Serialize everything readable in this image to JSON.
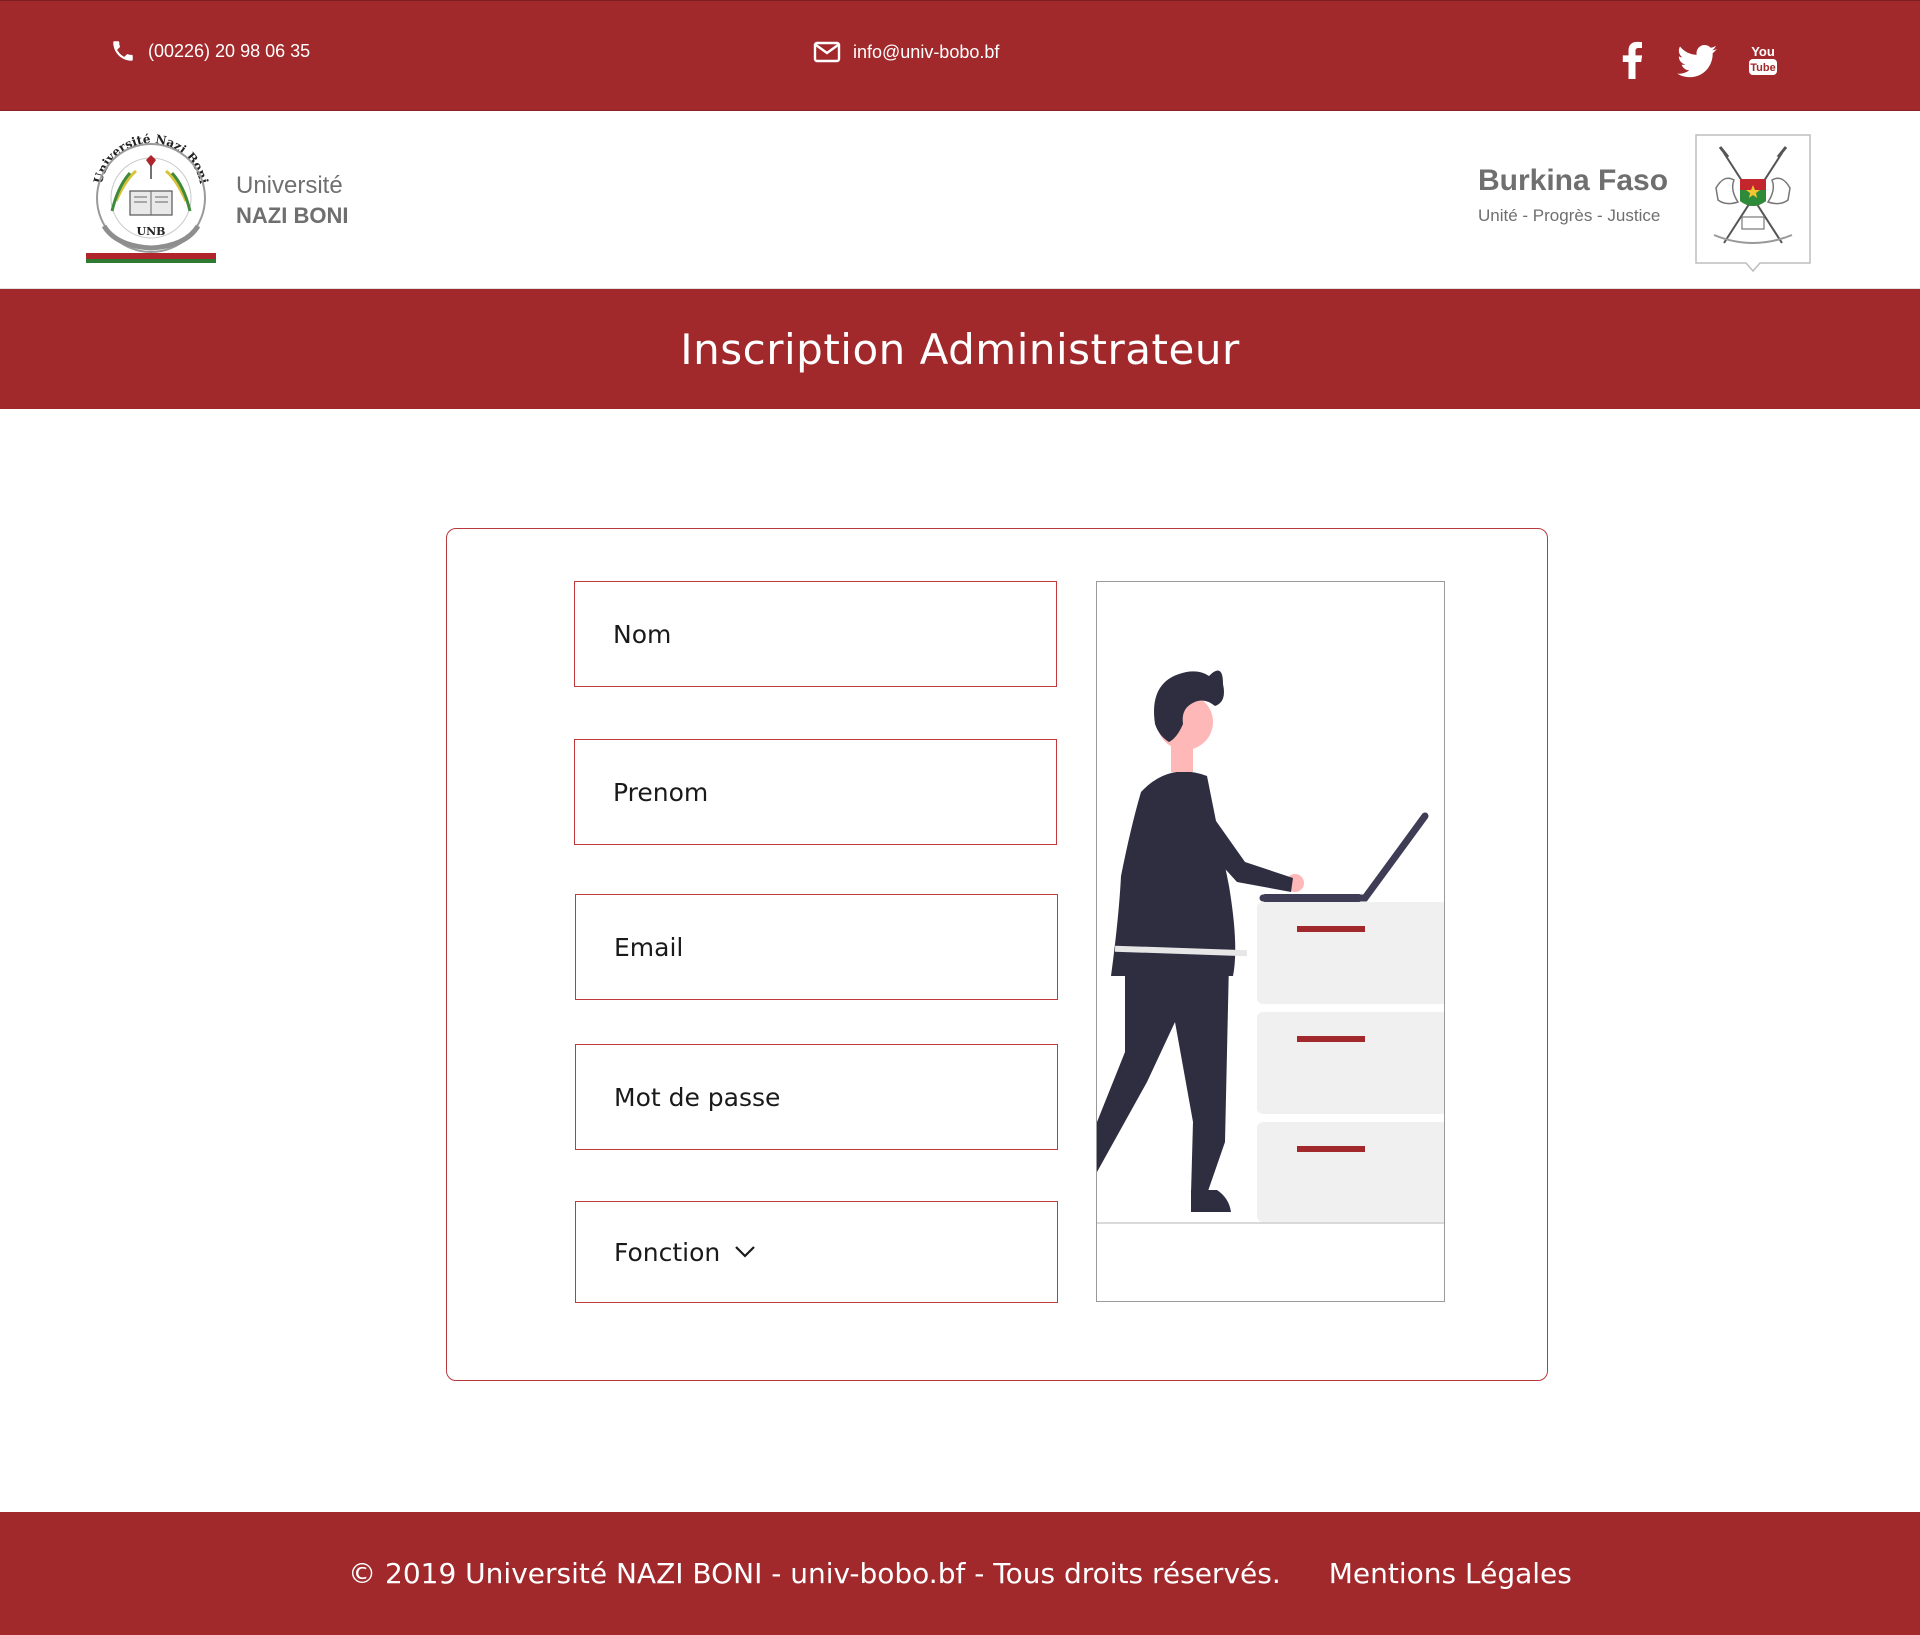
{
  "topbar": {
    "phone": "(00226) 20 98 06 35",
    "email": "info@univ-bobo.bf",
    "social": [
      "facebook-icon",
      "twitter-icon",
      "youtube-icon"
    ],
    "youtube_logo_text": "You Tube"
  },
  "header": {
    "university_line1": "Université",
    "university_line2": "NAZI BONI",
    "logo_text_arc": "Université Nazi Boni",
    "logo_text_center": "UNB",
    "country": "Burkina Faso",
    "motto": "Unité - Progrès - Justice"
  },
  "page": {
    "title": "Inscription Administrateur"
  },
  "form": {
    "nom_placeholder": "Nom",
    "prenom_placeholder": "Prenom",
    "email_placeholder": "Email",
    "password_placeholder": "Mot de passe",
    "fonction_label": "Fonction"
  },
  "footer": {
    "copyright": "© 2019 Université NAZI BONI - univ-bobo.bf - Tous droits réservés.",
    "legal_link": "Mentions Légales"
  },
  "colors": {
    "brand_red": "#a1282b",
    "text_gray": "#6f6f6f",
    "figure_dark": "#2f2e41",
    "cabinet_gray": "#f0f0f0"
  }
}
